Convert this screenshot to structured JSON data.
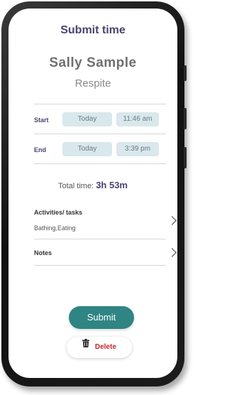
{
  "header": {
    "title": "Submit time"
  },
  "client": {
    "name": "Sally Sample",
    "service": "Respite"
  },
  "start": {
    "label": "Start",
    "date": "Today",
    "time": "11:46 am"
  },
  "end": {
    "label": "End",
    "date": "Today",
    "time": "3:39 pm"
  },
  "total": {
    "label": "Total time:",
    "value": "3h 53m"
  },
  "activities": {
    "label": "Activities/ tasks",
    "value": "Bathing,Eating"
  },
  "notes": {
    "label": "Notes"
  },
  "actions": {
    "submit_label": "Submit",
    "delete_label": "Delete"
  },
  "colors": {
    "accent": "#2f8583",
    "heading": "#4a4470",
    "pill": "#d8e8ec",
    "danger": "#c62828"
  },
  "icons": {
    "chevron": "chevron-right-icon",
    "trash": "trash-icon"
  }
}
